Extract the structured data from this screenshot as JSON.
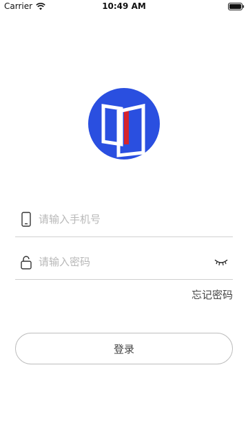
{
  "status_bar": {
    "carrier": "Carrier",
    "time": "10:49 AM",
    "icons": [
      "wifi-icon",
      "battery-icon"
    ]
  },
  "logo": {
    "icon": "app-logo-icon",
    "colors": {
      "circle": "#2a4fe0",
      "door": "#ffffff",
      "accent": "#d6232c"
    }
  },
  "phone_field": {
    "icon": "phone-icon",
    "value": "",
    "placeholder": "请输入手机号"
  },
  "password_field": {
    "icon": "lock-icon",
    "value": "",
    "placeholder": "请输入密码",
    "toggle_icon": "eye-closed-icon"
  },
  "forgot_password": "忘记密码",
  "login_button": "登录"
}
